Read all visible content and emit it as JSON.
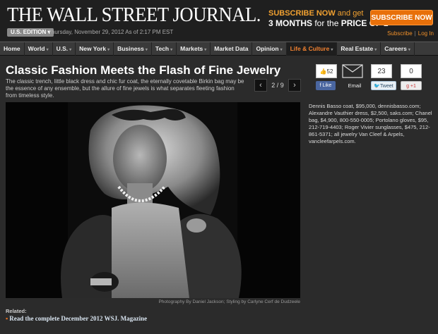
{
  "masthead": {
    "logo": "THE WALL STREET JOURNAL.",
    "edition": "U.S. EDITION ▾",
    "dateline": "Thursday, November 29, 2012 As of 2:17 PM EST",
    "promo_line1_strong": "SUBSCRIBE NOW",
    "promo_line1_rest": " and get",
    "promo_line2_strong": "3 MONTHS",
    "promo_line2_mid": " for the ",
    "promo_line2_end": "PRICE OF 1",
    "subscribe_button": "SUBSCRIBE NOW",
    "subscribe_link": "Subscribe",
    "login_link": "Log In"
  },
  "nav": {
    "items": [
      {
        "label": "Home",
        "caret": ""
      },
      {
        "label": "World",
        "caret": "▾"
      },
      {
        "label": "U.S.",
        "caret": "▾"
      },
      {
        "label": "New York",
        "caret": "▾"
      },
      {
        "label": "Business",
        "caret": "▾"
      },
      {
        "label": "Tech",
        "caret": "▾"
      },
      {
        "label": "Markets",
        "caret": "▾"
      },
      {
        "label": "Market Data",
        "caret": ""
      },
      {
        "label": "Opinion",
        "caret": "▾"
      },
      {
        "label": "Life & Culture",
        "caret": "▾"
      },
      {
        "label": "Real Estate",
        "caret": "▾"
      },
      {
        "label": "Careers",
        "caret": "▾"
      }
    ]
  },
  "article": {
    "headline": "Classic Fashion Meets the Flash of Fine Jewelry",
    "deck": "The classic trench, little black dress and chic fur coat, the eternally covetable Birkin bag may be the essence of any ensemble, but the allure of fine jewels is what separates fleeting fashion from timeless style.",
    "prev": "‹",
    "next": "›",
    "page_count": "2 / 9",
    "photo_credit": "Photography By Daniel Jackson; Styling by Carlyne Cerf de Dudzeele",
    "caption": "Dennis Basso coat, $95,000, dennisbasso.com; Alexandre Vauthier dress, $2,500, saks.com; Chanel bag, $4,900, 800-550-0005; Portolano gloves, $95, 212-719-4403; Roger Vivier sunglasses, $475, 212-861-5371; all jewelry Van Cleef & Arpels, vancleefarpels.com.",
    "related_label": "Related:",
    "related_link": "Read the complete December 2012 WSJ. Magazine"
  },
  "share": {
    "facebook_count": "52",
    "facebook_button": "Like",
    "email_button": "Email",
    "twitter_count": "23",
    "twitter_button": "Tweet",
    "gplus_count": "0",
    "gplus_button": "+1"
  },
  "colors": {
    "accent_orange": "#e8700a",
    "background": "#2b2b2b",
    "masthead_bg": "#1f1f1f",
    "nav_bg": "#3a3a3a",
    "active_nav_text": "#f08030"
  }
}
